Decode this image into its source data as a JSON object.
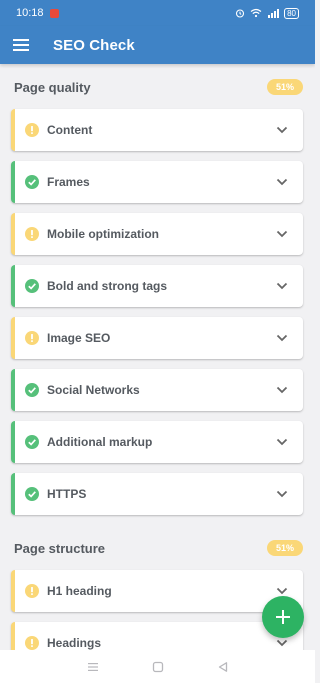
{
  "status_bar": {
    "time": "10:18",
    "battery": "80"
  },
  "app_bar": {
    "title": "SEO Check"
  },
  "sections": [
    {
      "title": "Page quality",
      "score": "51%",
      "items": [
        {
          "label": "Content",
          "status": "warning"
        },
        {
          "label": "Frames",
          "status": "ok"
        },
        {
          "label": "Mobile optimization",
          "status": "warning"
        },
        {
          "label": "Bold and strong tags",
          "status": "ok"
        },
        {
          "label": "Image SEO",
          "status": "warning"
        },
        {
          "label": "Social Networks",
          "status": "ok"
        },
        {
          "label": "Additional markup",
          "status": "ok"
        },
        {
          "label": "HTTPS",
          "status": "ok"
        }
      ]
    },
    {
      "title": "Page structure",
      "score": "51%",
      "items": [
        {
          "label": "H1 heading",
          "status": "warning"
        },
        {
          "label": "Headings",
          "status": "warning"
        }
      ]
    }
  ],
  "colors": {
    "primary": "#3f83c6",
    "warning": "#fad777",
    "ok": "#56c07a",
    "fab": "#2db363"
  },
  "icons": {
    "menu": "hamburger-menu-icon",
    "warning": "exclamation-circle-icon",
    "ok": "check-circle-icon",
    "expand": "chevron-down-icon",
    "fab": "plus-icon"
  }
}
